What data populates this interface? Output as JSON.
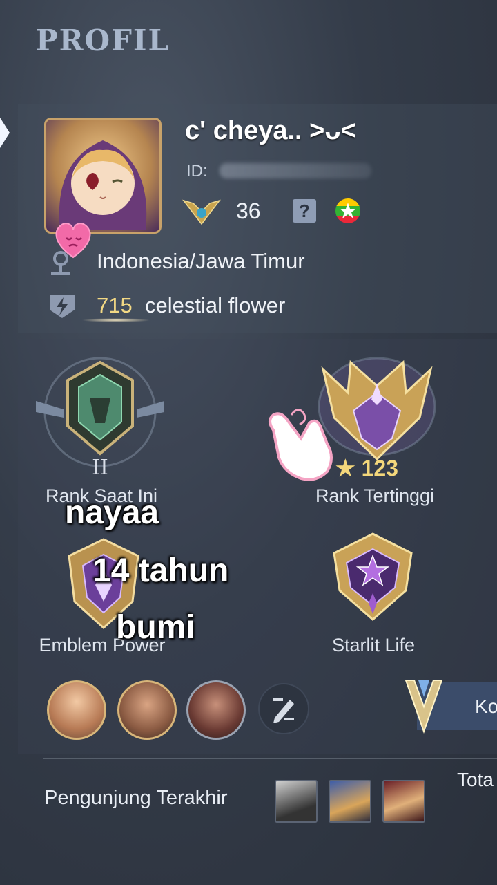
{
  "header": {
    "title": "PROFIL"
  },
  "profile": {
    "name": "c' cheya.. >ᴗ<",
    "id_label": "ID:",
    "level": "36",
    "help_symbol": "?",
    "location": "Indonesia/Jawa Timur",
    "points_value": "715",
    "points_label": "celestial flower"
  },
  "stats": {
    "rank_current": {
      "tier_mark": "II",
      "label": "Rank Saat Ini"
    },
    "rank_highest": {
      "stars": "★ 123",
      "label": "Rank Tertinggi"
    },
    "emblem": {
      "label": "Emblem Power"
    },
    "starlit": {
      "label": "Starlit Life"
    }
  },
  "overlay_text": [
    "nayaa",
    "14 tahun",
    "bumi"
  ],
  "side_tab": {
    "label": "Ko"
  },
  "footer": {
    "total_label": "Tota",
    "visitors_label": "Pengunjung Terakhir"
  },
  "colors": {
    "accent_gold": "#f4d77b",
    "background": "#343c49",
    "title": "#a9b7cc"
  },
  "icons": [
    "location-pin-icon",
    "lightning-shield-icon",
    "level-badge-icon",
    "help-icon",
    "country-flag-icon",
    "edit-icon"
  ]
}
